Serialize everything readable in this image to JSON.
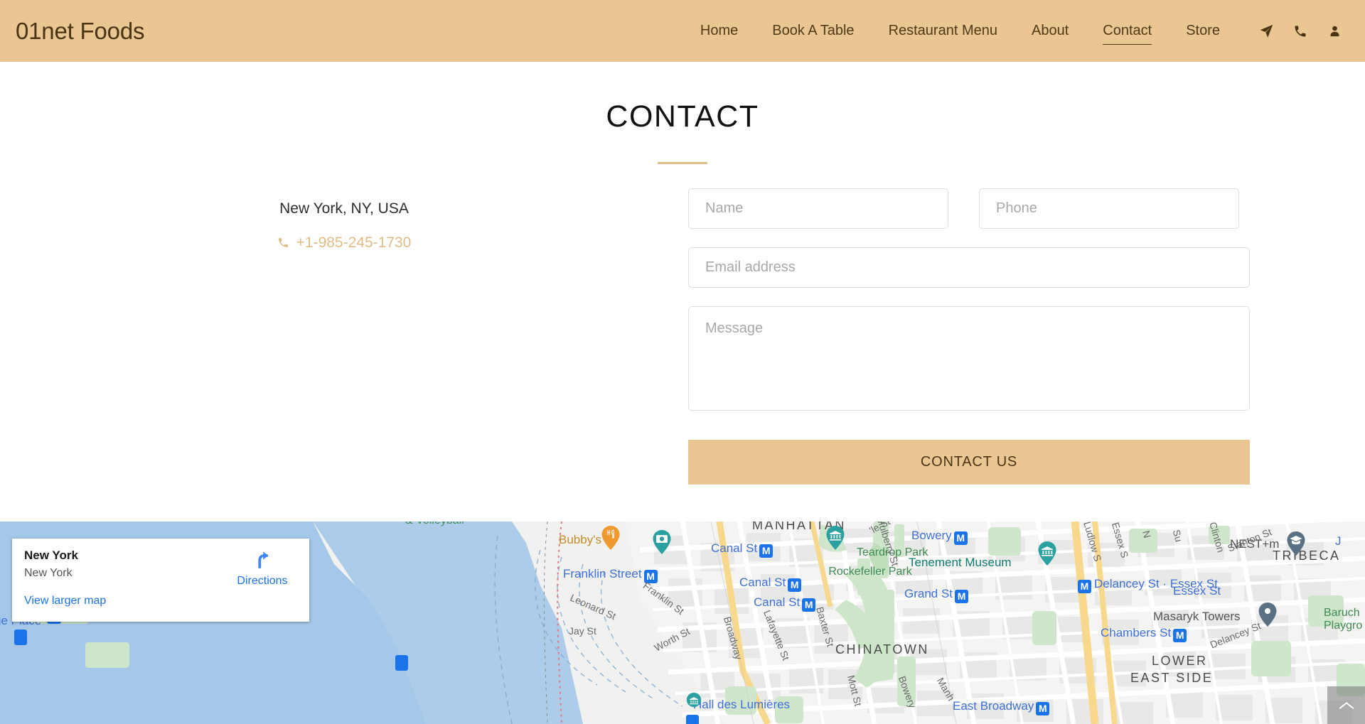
{
  "header": {
    "brand": "01net Foods",
    "nav": [
      {
        "label": "Home",
        "active": false
      },
      {
        "label": "Book A Table",
        "active": false
      },
      {
        "label": "Restaurant Menu",
        "active": false
      },
      {
        "label": "About",
        "active": false
      },
      {
        "label": "Contact",
        "active": true
      },
      {
        "label": "Store",
        "active": false
      }
    ],
    "icons": [
      {
        "name": "navigation-arrow-icon"
      },
      {
        "name": "phone-icon"
      },
      {
        "name": "user-account-icon"
      }
    ],
    "colors": {
      "background": "#e9c692",
      "text": "#4a3414"
    }
  },
  "main": {
    "title": "CONTACT",
    "divider_color": "#e0bd87",
    "info": {
      "address": "New York, NY, USA",
      "phone": "+1-985-245-1730",
      "phone_color": "#e0bd87"
    },
    "form": {
      "name_placeholder": "Name",
      "phone_placeholder": "Phone",
      "email_placeholder": "Email address",
      "message_placeholder": "Message",
      "name_value": "",
      "phone_value": "",
      "email_value": "",
      "message_value": "",
      "submit_label": "CONTACT US",
      "submit_color": "#e9c692"
    }
  },
  "map": {
    "card": {
      "title": "New York",
      "subtitle": "New York",
      "directions_label": "Directions",
      "view_larger_label": "View larger map"
    },
    "scroll_top_icon": "chevron-up-icon",
    "labels": {
      "exchange_place": "ge Place",
      "teardrop_park": "Teardrop Park",
      "rockefeller_park": "Rockefeller Park",
      "tribeca": "TRIBECA",
      "chambers_st": "Chambers St",
      "bubbys": "Bubby's",
      "franklin_street": "Franklin Street",
      "leonard_st": "Leonard St",
      "franklin_st": "Franklin St",
      "jay_st": "Jay St",
      "worth_st": "Worth St",
      "broadway": "Broadway",
      "lafayette_st": "Lafayette St",
      "baxter_st": "Baxter St",
      "mott_st": "Mott St",
      "bowery_st": "Bowery",
      "manhattan": "MANHATTAN",
      "canal_st_1": "Canal St",
      "canal_st_2": "Canal St",
      "canal_st_3": "Canal St",
      "mulberry_st": "Mulberry St",
      "bowery": "Bowery",
      "tenement_museum": "Tenement Museum",
      "grand_st": "Grand St",
      "delancey_essex": "Delancey St · Essex St",
      "ludlow_st": "Ludlow S",
      "essex_st": "Essex S",
      "essex_st_2": "Essex St",
      "clinton_st": "Clinton",
      "stanton_st": "Stanton St",
      "nest_m": "NEST+m",
      "masaryk_towers": "Masaryk Towers",
      "delancey_st": "Delancey St",
      "baruch_playground": "Baruch Playgro",
      "chinatown": "CHINATOWN",
      "lower_east_side_1": "LOWER",
      "lower_east_side_2": "EAST SIDE",
      "hall_des_lumieres": "Hall des Lumières",
      "east_broadway": "East Broadway",
      "volleyball": "& Volleyball",
      "nest_partial": "J",
      "sub_partial": "Su",
      "n_partial": "N",
      "stanton_partial": "Stanton St",
      "baruch_partial": "Baruc"
    }
  }
}
